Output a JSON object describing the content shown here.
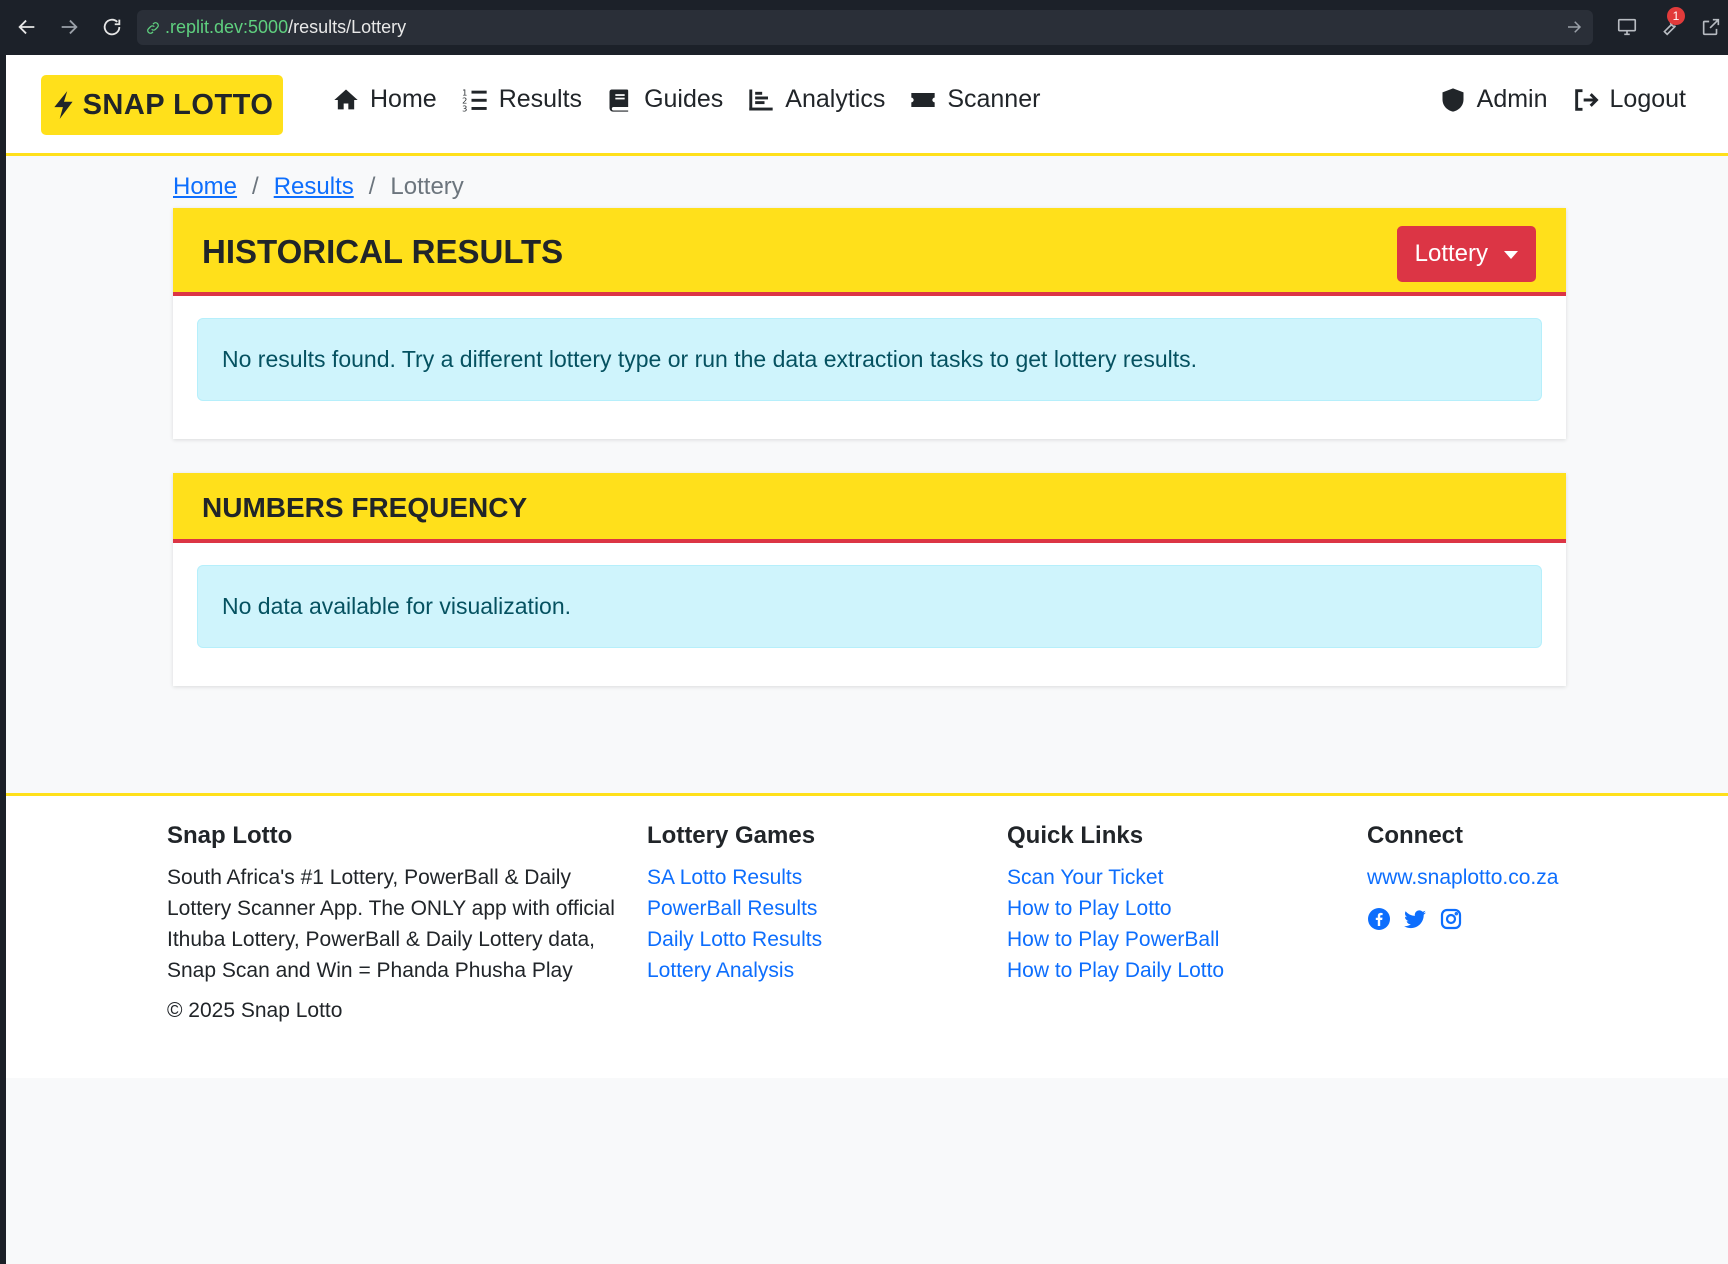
{
  "browser": {
    "url_host": ".replit.dev:5000",
    "url_path": "/results/Lottery",
    "notification_count": "1"
  },
  "navbar": {
    "brand": "SNAP LOTTO",
    "links": [
      {
        "label": "Home",
        "icon": "home-icon"
      },
      {
        "label": "Results",
        "icon": "list-ol-icon"
      },
      {
        "label": "Guides",
        "icon": "book-icon"
      },
      {
        "label": "Analytics",
        "icon": "chart-icon"
      },
      {
        "label": "Scanner",
        "icon": "ticket-icon"
      }
    ],
    "right_links": [
      {
        "label": "Admin",
        "icon": "shield-icon"
      },
      {
        "label": "Logout",
        "icon": "logout-icon"
      }
    ]
  },
  "breadcrumb": {
    "home": "Home",
    "results": "Results",
    "current": "Lottery"
  },
  "historical": {
    "title": "HISTORICAL RESULTS",
    "dropdown_label": "Lottery",
    "message": "No results found. Try a different lottery type or run the data extraction tasks to get lottery results."
  },
  "frequency": {
    "title": "NUMBERS FREQUENCY",
    "message": "No data available for visualization."
  },
  "footer": {
    "about": {
      "heading": "Snap Lotto",
      "lines": [
        "South Africa's #1 Lottery, PowerBall & Daily",
        "Lottery Scanner App. The ONLY app with official",
        "Ithuba Lottery, PowerBall & Daily Lottery data,",
        "Snap Scan and Win = Phanda Phusha Play"
      ],
      "copyright": "© 2025 Snap Lotto"
    },
    "games": {
      "heading": "Lottery Games",
      "links": [
        "SA Lotto Results",
        "PowerBall Results",
        "Daily Lotto Results",
        "Lottery Analysis"
      ]
    },
    "quick": {
      "heading": "Quick Links",
      "links": [
        "Scan Your Ticket",
        "How to Play Lotto",
        "How to Play PowerBall",
        "How to Play Daily Lotto"
      ]
    },
    "connect": {
      "heading": "Connect",
      "website": "www.snaplotto.co.za",
      "social": [
        "facebook-icon",
        "twitter-icon",
        "instagram-icon"
      ]
    }
  },
  "colors": {
    "brand_yellow": "#ffe01b",
    "accent_red": "#dc3545",
    "link_blue": "#0d6efd",
    "info_bg": "#cff4fc"
  }
}
